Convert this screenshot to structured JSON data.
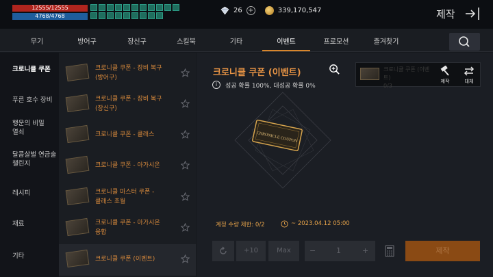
{
  "status": {
    "hp": "12555/12555",
    "mp": "4768/4768",
    "buff_icons": [
      "buff-icon",
      "buff-icon",
      "buff-icon",
      "buff-icon",
      "buff-icon",
      "buff-icon",
      "buff-icon",
      "buff-icon",
      "buff-icon",
      "buff-icon",
      "buff-icon",
      "buff-icon",
      "buff-icon",
      "buff-icon",
      "buff-icon",
      "buff-icon",
      "buff-icon",
      "buff-icon",
      "buff-icon",
      "buff-icon"
    ]
  },
  "currency": {
    "diamond": "26",
    "gold": "339,170,547"
  },
  "header": {
    "title": "제작"
  },
  "tabs": [
    "무기",
    "방어구",
    "장신구",
    "스킬북",
    "기타",
    "이벤트",
    "프로모션",
    "즐겨찾기"
  ],
  "active_tab": "이벤트",
  "categories": [
    "크로니클 쿠폰",
    "푸른 호수 장비",
    "행운의 비밀\n열쇠",
    "달콤살벌 연금술\n챌린지",
    "레시피",
    "재료",
    "기타"
  ],
  "items": [
    {
      "name": "크로니클 쿠폰 - 장비 복구\n(방어구)"
    },
    {
      "name": "크로니클 쿠폰 - 장비 복구\n(장신구)"
    },
    {
      "name": "크로니클 쿠폰 - 클래스"
    },
    {
      "name": "크로니클 쿠폰 - 아가시온"
    },
    {
      "name": "크로니클 마스터 쿠폰 -\n클래스 초월"
    },
    {
      "name": "크로니클 쿠폰 - 아가시온\n융합"
    },
    {
      "name": "크로니클 쿠폰 (이벤트)"
    }
  ],
  "detail": {
    "title": "크로니클 쿠폰 (이벤트)",
    "rates": "성공 확률 100%, 대성공 확률 0%",
    "material_label": "크로니클 쿠폰 (이벤트)\n0/3",
    "make_action": "제작",
    "replace_action": "대체",
    "coupon_art_text": "CHRONICLE COUPON",
    "limit": "계정 수량 제한: 0/2",
    "date": "~ 2023.04.12 05:00"
  },
  "controls": {
    "plus10": "+10",
    "max": "Max",
    "minus": "−",
    "quantity": "1",
    "plus": "+",
    "craft": "제작"
  },
  "colors": {
    "accent": "#d8862c",
    "item_text": "#d98a3c",
    "hp_bar": "#b0251e",
    "mp_bar": "#1f5d9c"
  }
}
